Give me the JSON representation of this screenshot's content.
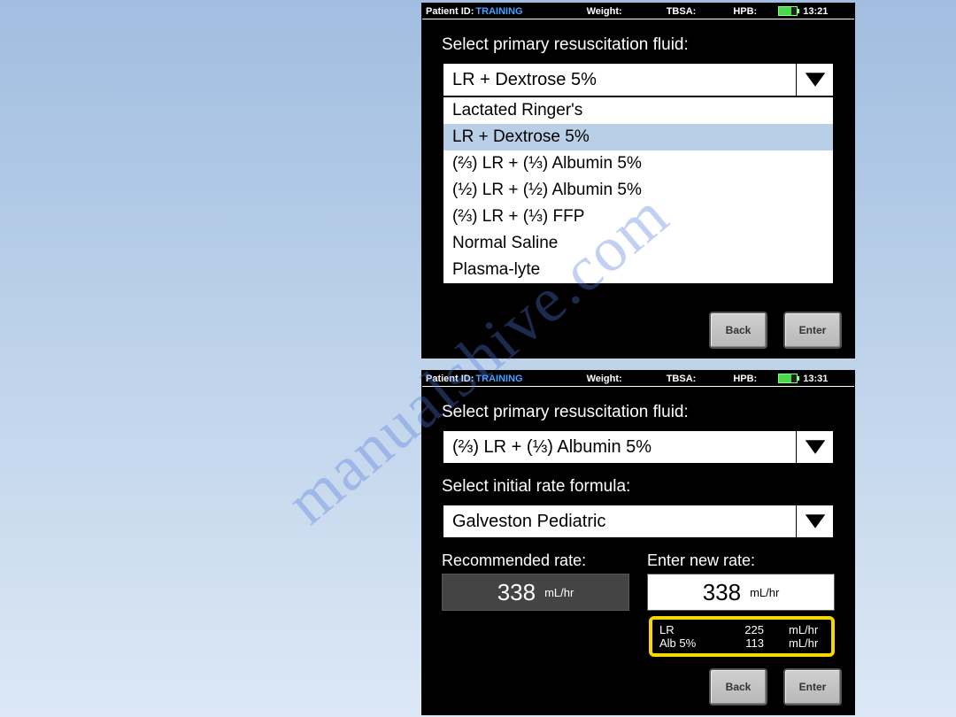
{
  "watermark": "manualshive.com",
  "screen1": {
    "status": {
      "patient_id_label": "Patient ID:",
      "patient_id_value": "TRAINING",
      "weight_label": "Weight:",
      "tbsa_label": "TBSA:",
      "hpb_label": "HPB:",
      "time": "13:21"
    },
    "prompt": "Select primary resuscitation fluid:",
    "selected": "LR + Dextrose 5%",
    "options": [
      "Lactated Ringer's",
      "LR + Dextrose 5%",
      "(⅔) LR + (⅓) Albumin 5%",
      "(½) LR + (½) Albumin 5%",
      "(⅔) LR + (⅓) FFP",
      "Normal Saline",
      "Plasma-lyte"
    ],
    "highlight_index": 1,
    "buttons": {
      "back": "Back",
      "enter": "Enter"
    }
  },
  "screen2": {
    "status": {
      "patient_id_label": "Patient ID:",
      "patient_id_value": "TRAINING",
      "weight_label": "Weight:",
      "tbsa_label": "TBSA:",
      "hpb_label": "HPB:",
      "time": "13:31"
    },
    "prompt_fluid": "Select primary resuscitation fluid:",
    "fluid_selected": "(⅔) LR + (⅓) Albumin 5%",
    "prompt_formula": "Select initial rate formula:",
    "formula_selected": "Galveston Pediatric",
    "recommended_label": "Recommended rate:",
    "recommended_value": "338",
    "recommended_unit": "mL/hr",
    "enter_label": "Enter new rate:",
    "enter_value": "338",
    "enter_unit": "mL/hr",
    "breakdown": [
      {
        "name": "LR",
        "value": "225",
        "unit": "mL/hr"
      },
      {
        "name": "Alb 5%",
        "value": "113",
        "unit": "mL/hr"
      }
    ],
    "buttons": {
      "back": "Back",
      "enter": "Enter"
    }
  }
}
